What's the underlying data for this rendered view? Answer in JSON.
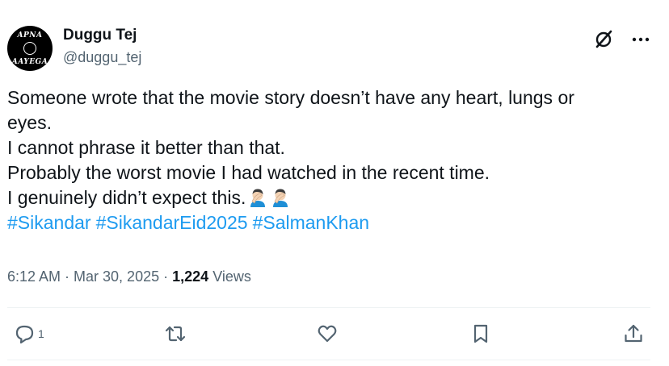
{
  "author": {
    "name": "Duggu Tej",
    "handle": "@duggu_tej",
    "avatar_text_top": "APNA",
    "avatar_text_bottom": "AAYEGA"
  },
  "tweet": {
    "lines": [
      "Someone wrote that the movie story doesn’t have any heart, lungs or",
      "eyes.",
      "I cannot phrase it better than that.",
      "Probably the worst movie I had watched in the recent time.",
      "I genuinely didn’t expect this."
    ],
    "emoji": "facepalm-emoji",
    "hashtags": [
      "#Sikandar",
      "#SikandarEid2025",
      "#SalmanKhan"
    ]
  },
  "meta": {
    "timestamp": "6:12 AM · Mar 30, 2025 ·",
    "views_count": "1,224",
    "views_label": "Views"
  },
  "actions": {
    "reply_count": "1"
  },
  "colors": {
    "text": "#0f1419",
    "secondary": "#536471",
    "link": "#1d9bf0",
    "divider": "#eff3f4"
  },
  "icons": [
    "grok-icon",
    "more-icon",
    "reply-icon",
    "retweet-icon",
    "like-icon",
    "bookmark-icon",
    "share-icon"
  ]
}
